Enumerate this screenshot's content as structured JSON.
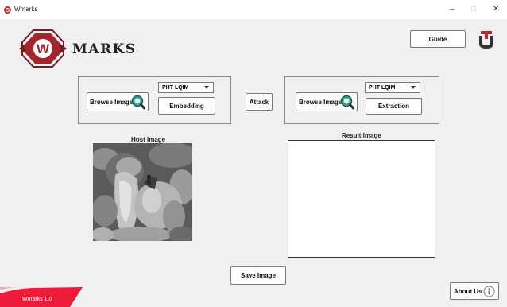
{
  "window": {
    "title": "Wmarks",
    "min": "–",
    "max": "□",
    "close": "✕"
  },
  "header": {
    "logo_letter": "W",
    "logo_text": "MARKS",
    "guide_label": "Guide"
  },
  "embed_panel": {
    "method_selected": "PHT LQIM",
    "browse_label": "Browse Image",
    "action_label": "Embedding"
  },
  "attack_label": "Attack",
  "extract_panel": {
    "method_selected": "PHT LQIM",
    "browse_label": "Browse Image",
    "action_label": "Extraction"
  },
  "host": {
    "caption": "Host Image"
  },
  "result": {
    "caption": "Result Image"
  },
  "footer": {
    "save_label": "Save Image",
    "about_label": "About Us",
    "version": "Wmarks 1.0"
  },
  "icons": {
    "app": "wmarks-icon",
    "browse": "magnifier-icon",
    "about": "info-icon",
    "university": "telkom-u-logo-icon"
  },
  "colors": {
    "brand_red": "#a3262e",
    "accent_teal": "#3a9b94",
    "panel_bg": "#f0f0f0"
  }
}
